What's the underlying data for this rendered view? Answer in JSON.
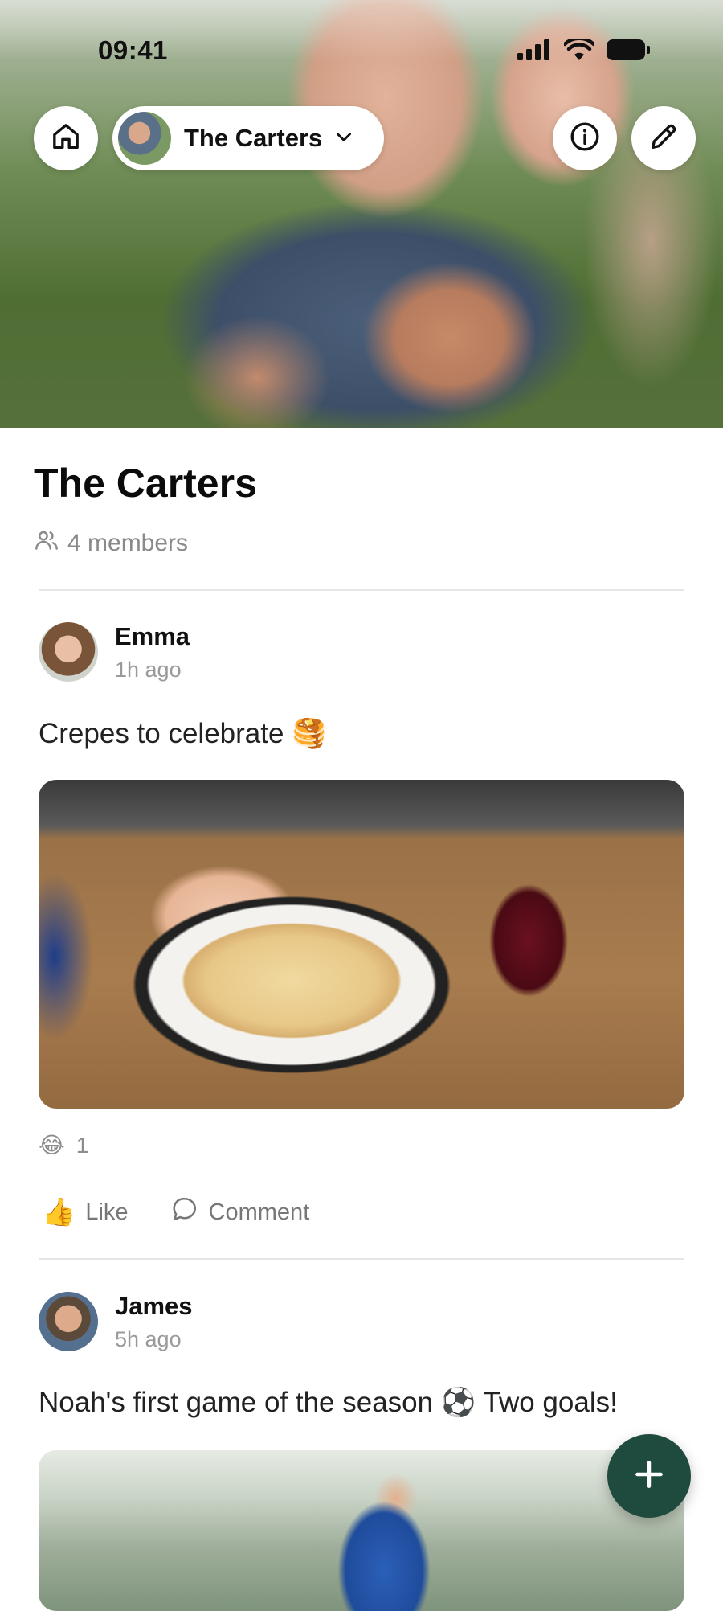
{
  "status_bar": {
    "time": "09:41"
  },
  "header": {
    "group_name": "The Carters"
  },
  "group": {
    "title": "The Carters",
    "members_label": "4 members"
  },
  "posts": [
    {
      "author": "Emma",
      "time": "1h ago",
      "text": "Crepes to celebrate 🥞",
      "reaction": {
        "emoji": "😂",
        "count": "1"
      },
      "actions": {
        "like_emoji": "👍",
        "like_label": "Like",
        "comment_label": "Comment"
      }
    },
    {
      "author": "James",
      "time": "5h ago",
      "text": "Noah's first game of the season ⚽ Two goals!"
    }
  ],
  "colors": {
    "fab": "#1f4a3e",
    "divider": "#e6e6e6",
    "meta_text": "#9a9a9a"
  },
  "icons": [
    "home-icon",
    "chevron-down-icon",
    "info-icon",
    "pencil-icon",
    "members-icon",
    "comment-icon",
    "plus-icon",
    "signal-icon",
    "wifi-icon",
    "battery-icon"
  ]
}
